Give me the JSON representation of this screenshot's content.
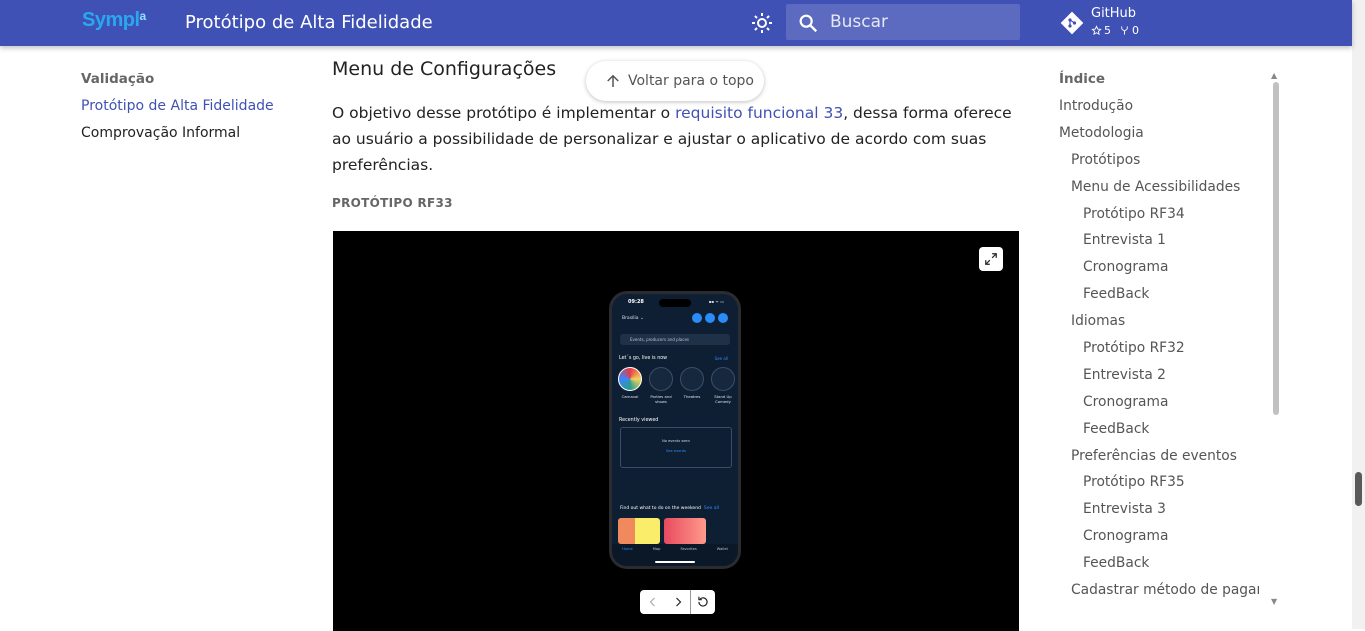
{
  "header": {
    "logo": "Sympl",
    "logo_mark": "a",
    "title": "Protótipo de Alta Fidelidade",
    "search_placeholder": "Buscar",
    "repo": {
      "name": "GitHub",
      "stars": "5",
      "forks": "0"
    },
    "accent_color": "#3f51b5"
  },
  "left_nav": {
    "section": "Validação",
    "items": [
      {
        "label": "Protótipo de Alta Fidelidade",
        "active": true
      },
      {
        "label": "Comprovação Informal",
        "active": false
      }
    ]
  },
  "main": {
    "heading": "Menu de Configurações",
    "paragraph_before": "O objetivo desse protótipo é implementar o ",
    "paragraph_link": "requisito funcional 33",
    "paragraph_after": ", dessa forma oferece ao usuário a possibilidade de personalizar e ajustar o aplicativo de acordo com suas preferências.",
    "caption": "PROTÓTIPO RF33",
    "back_to_top": "Voltar para o topo"
  },
  "phone": {
    "time": "09:28",
    "status": "▪▪ ᯤ ▭",
    "location": "Brasília ⌄",
    "search": "Events, producers and places",
    "section_now": "Let´s go, live is now",
    "see_all": "See all",
    "categories": [
      "Carnaval",
      "Parties and shows",
      "Theatres",
      "Stand Up Comedy"
    ],
    "recently_viewed": "Recently viewed",
    "no_events": "No events seen",
    "see_events": "See events",
    "weekend": "Find out what to do on the weekend",
    "tabs": [
      "Home",
      "Map",
      "Favorites",
      "Wallet"
    ]
  },
  "toc": {
    "title": "Índice",
    "items": [
      {
        "label": "Introdução",
        "level": 1
      },
      {
        "label": "Metodologia",
        "level": 1
      },
      {
        "label": "Protótipos",
        "level": 2
      },
      {
        "label": "Menu de Acessibilidades",
        "level": 2
      },
      {
        "label": "Protótipo RF34",
        "level": 3
      },
      {
        "label": "Entrevista 1",
        "level": 3
      },
      {
        "label": "Cronograma",
        "level": 3
      },
      {
        "label": "FeedBack",
        "level": 3
      },
      {
        "label": "Idiomas",
        "level": 2
      },
      {
        "label": "Protótipo RF32",
        "level": 3
      },
      {
        "label": "Entrevista 2",
        "level": 3
      },
      {
        "label": "Cronograma",
        "level": 3
      },
      {
        "label": "FeedBack",
        "level": 3
      },
      {
        "label": "Preferências de eventos",
        "level": 2
      },
      {
        "label": "Protótipo RF35",
        "level": 3
      },
      {
        "label": "Entrevista 3",
        "level": 3
      },
      {
        "label": "Cronograma",
        "level": 3
      },
      {
        "label": "FeedBack",
        "level": 3
      },
      {
        "label": "Cadastrar método de pagamento",
        "level": 2
      }
    ]
  }
}
